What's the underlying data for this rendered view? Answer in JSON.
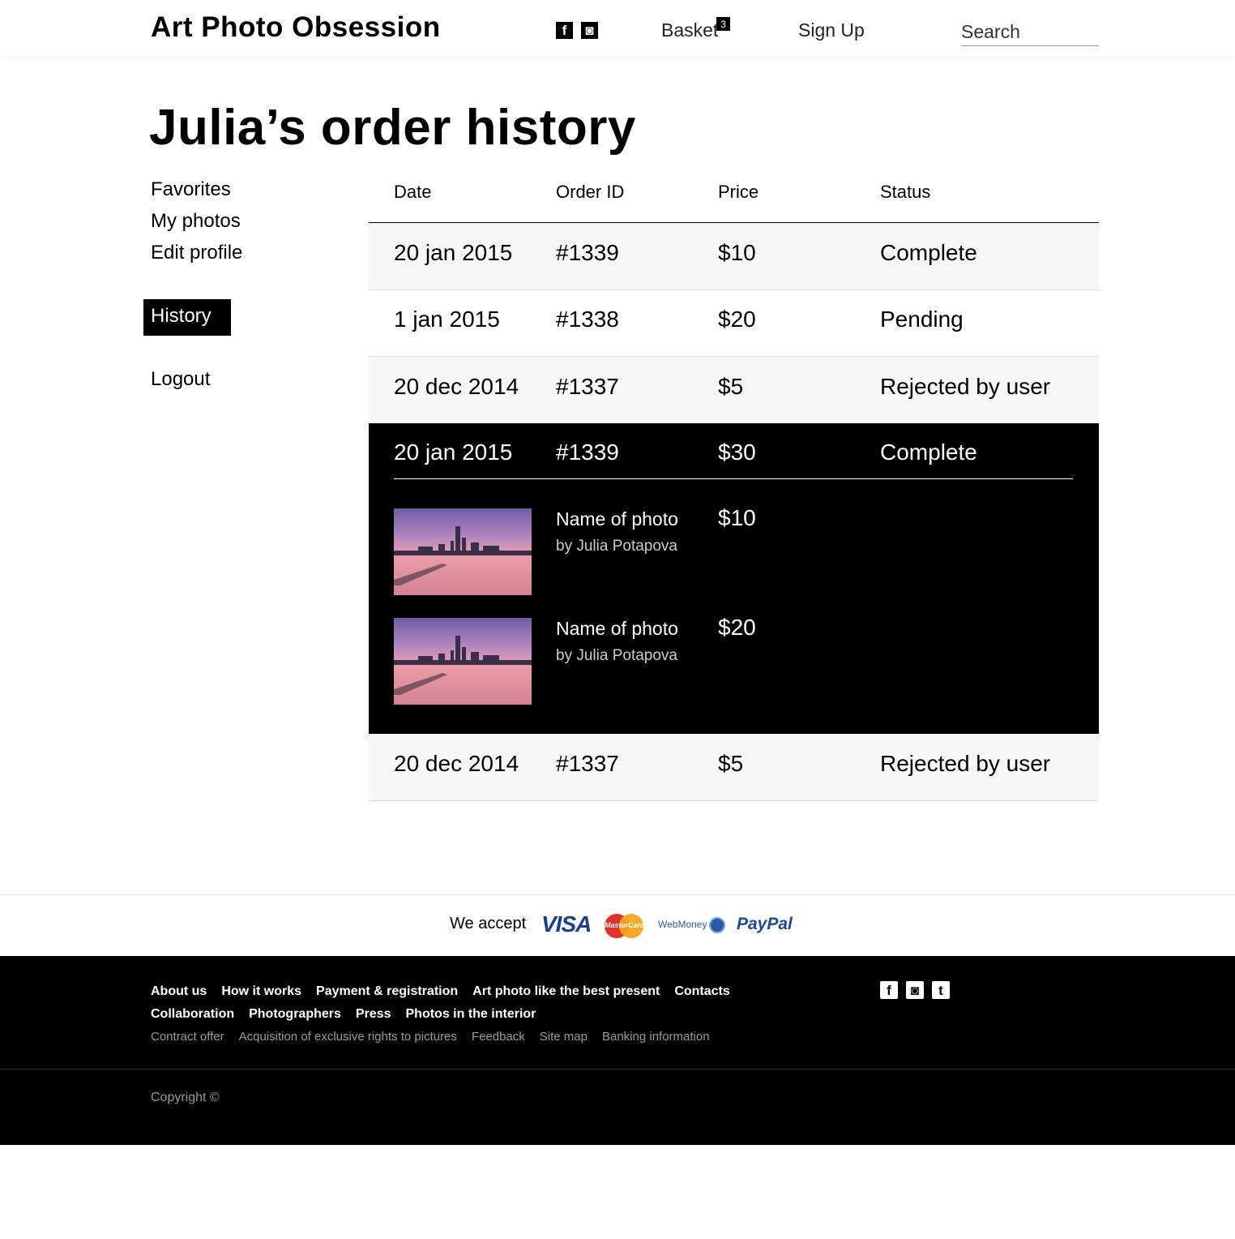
{
  "header": {
    "logo": "Art Photo Obsession",
    "social": [
      {
        "icon": "facebook-icon",
        "glyph": "f"
      },
      {
        "icon": "instagram-icon",
        "glyph": "◙"
      }
    ],
    "basket_label": "Basket",
    "basket_count": "3",
    "signup_label": "Sign Up",
    "search_placeholder": "Search"
  },
  "page_title": "Julia’s order history",
  "sidebar": {
    "items": [
      "Favorites",
      "My photos",
      "Edit profile"
    ],
    "active": "History",
    "logout": "Logout"
  },
  "table": {
    "columns": [
      "Date",
      "Order ID",
      "Price",
      "Status"
    ],
    "rows": [
      {
        "date": "20 jan 2015",
        "id": "#1339",
        "price": "$10",
        "status": "Complete"
      },
      {
        "date": "1 jan 2015",
        "id": "#1338",
        "price": "$20",
        "status": "Pending"
      },
      {
        "date": "20 dec 2014",
        "id": "#1337",
        "price": "$5",
        "status": "Rejected by user"
      }
    ],
    "expanded": {
      "date": "20 jan 2015",
      "id": "#1339",
      "price": "$30",
      "status": "Complete",
      "items": [
        {
          "name": "Name of photo",
          "author": "by Julia Potapova",
          "price": "$10"
        },
        {
          "name": "Name of photo",
          "author": "by Julia Potapova",
          "price": "$20"
        }
      ]
    },
    "last_row": {
      "date": "20 dec 2014",
      "id": "#1337",
      "price": "$5",
      "status": "Rejected by user"
    }
  },
  "payment": {
    "label": "We accept",
    "visa": "VISA",
    "mastercard": "MasterCard",
    "webmoney": "WebMoney",
    "paypal": "PayPal"
  },
  "footer": {
    "main_links_1": [
      "About us",
      "How it works",
      "Payment & registration",
      "Art photo like the best present",
      "Contacts"
    ],
    "main_links_2": [
      "Collaboration",
      "Photographers",
      "Press",
      "Photos in the interior"
    ],
    "sub_links": [
      "Contract offer",
      "Acquisition of exclusive rights to pictures",
      "Feedback",
      "Site map",
      "Banking information"
    ],
    "social": [
      {
        "icon": "facebook-icon",
        "glyph": "f"
      },
      {
        "icon": "instagram-icon",
        "glyph": "◙"
      },
      {
        "icon": "tumblr-icon",
        "glyph": "t"
      }
    ],
    "copyright": "Copyright ©"
  }
}
